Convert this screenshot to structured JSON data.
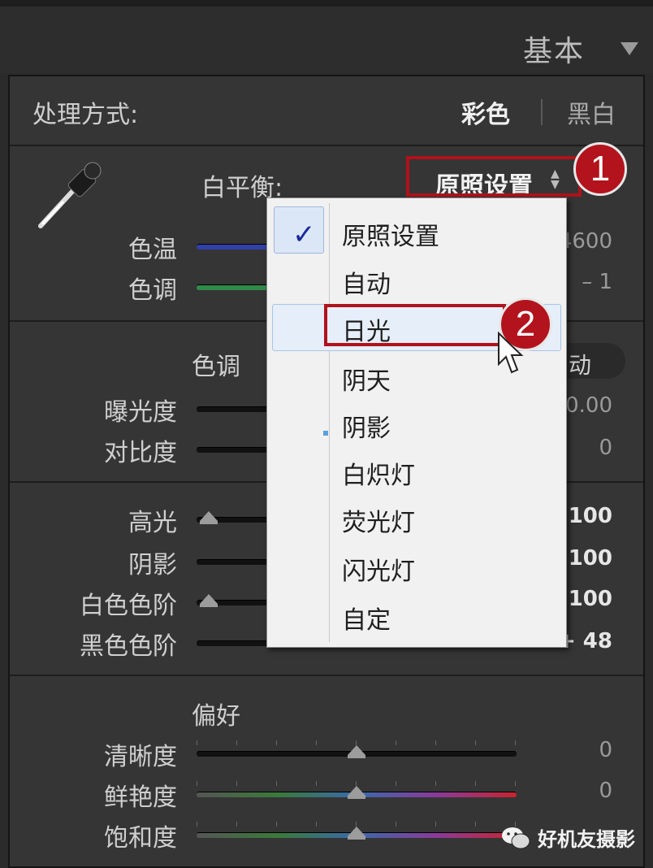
{
  "header": {
    "title": "基本"
  },
  "treatment": {
    "label": "处理方式:",
    "color": "彩色",
    "bw": "黑白"
  },
  "wb": {
    "label": "白平衡:",
    "selected": "原照设置"
  },
  "temp": {
    "label": "色温",
    "value": "4600"
  },
  "tint": {
    "label": "色调",
    "value": "– 1"
  },
  "tone": {
    "header": "色调",
    "auto": "动",
    "exposure": {
      "label": "曝光度",
      "value": "0.00"
    },
    "contrast": {
      "label": "对比度",
      "value": "0"
    }
  },
  "highlights": {
    "label": "高光",
    "value": "100"
  },
  "shadows": {
    "label": "阴影",
    "value": "100"
  },
  "whites": {
    "label": "白色色阶",
    "value": "100"
  },
  "blacks": {
    "label": "黑色色阶",
    "value": "+ 48"
  },
  "presence": {
    "header": "偏好",
    "clarity": {
      "label": "清晰度",
      "value": "0"
    },
    "vibrance": {
      "label": "鲜艳度",
      "value": "0"
    },
    "saturation": {
      "label": "饱和度"
    }
  },
  "menu": {
    "items": [
      "原照设置",
      "自动",
      "日光",
      "阴天",
      "阴影",
      "白炽灯",
      "荧光灯",
      "闪光灯",
      "自定"
    ],
    "checked": "原照设置",
    "hovered": "日光"
  },
  "badges": {
    "one": "1",
    "two": "2"
  },
  "watermark": {
    "text": "好机友摄影"
  },
  "colors": {
    "accent": "#b0121b",
    "panel": "#353535",
    "menu": "#f1f1f1"
  }
}
